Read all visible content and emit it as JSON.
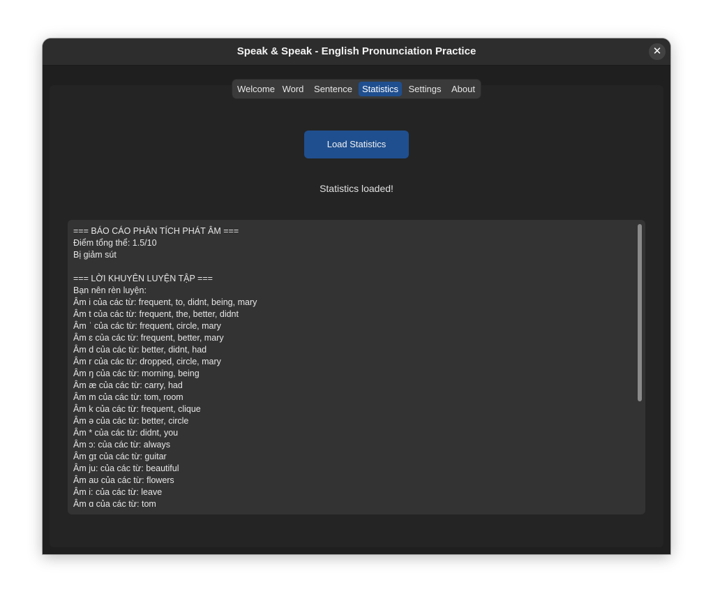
{
  "window": {
    "title": "Speak & Speak - English Pronunciation Practice",
    "close_glyph": "✕"
  },
  "tabs": [
    {
      "label": "Welcome",
      "active": false
    },
    {
      "label": "Word",
      "active": false
    },
    {
      "label": "Sentence",
      "active": false
    },
    {
      "label": "Statistics",
      "active": true
    },
    {
      "label": "Settings",
      "active": false
    },
    {
      "label": "About",
      "active": false
    }
  ],
  "statistics": {
    "load_button_label": "Load Statistics",
    "status_text": "Statistics loaded!",
    "report_lines": [
      "=== BÁO CÁO PHÂN TÍCH PHÁT ÂM ===",
      "Điểm tổng thể: 1.5/10",
      "Bị giảm sút",
      "",
      "=== LỜI KHUYÊN LUYỆN TẬP ===",
      "Bạn nên rèn luyện:",
      "Âm i của các từ: frequent, to, didnt, being, mary",
      "Âm t của các từ: frequent, the, better, didnt",
      "Âm ˈ của các từ: frequent, circle, mary",
      "Âm ɛ của các từ: frequent, better, mary",
      "Âm d của các từ: better, didnt, had",
      "Âm r của các từ: dropped, circle, mary",
      "Âm ŋ của các từ: morning, being",
      "Âm æ của các từ: carry, had",
      "Âm m của các từ: tom, room",
      "Âm k của các từ: frequent, clique",
      "Âm ə của các từ: better, circle",
      "Âm * của các từ: didnt, you",
      "Âm ɔ: của các từ: always",
      "Âm gɪ của các từ: guitar",
      "Âm ju: của các từ: beautiful",
      "Âm aʊ của các từ: flowers",
      "Âm i: của các từ: leave",
      "Âm ɑ của các từ: tom"
    ]
  },
  "colors": {
    "accent": "#1f4f8f",
    "window_bg": "#1f1f1f",
    "titlebar_bg": "#2d2d2d",
    "panel_bg": "#242424",
    "report_bg": "#333333"
  }
}
